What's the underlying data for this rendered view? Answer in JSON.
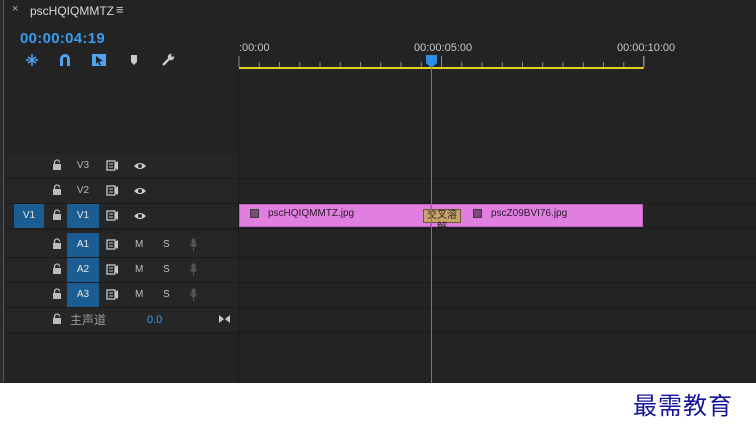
{
  "tab": {
    "close": "×",
    "title": "pscHQIQMMTZ",
    "menu": "≡"
  },
  "timecode": "00:00:04:19",
  "tools": [
    {
      "icon": "nest-icon"
    },
    {
      "icon": "snap-icon"
    },
    {
      "icon": "linked-selection-icon"
    },
    {
      "icon": "add-marker-icon"
    },
    {
      "icon": "settings-wrench-icon"
    }
  ],
  "ruler": {
    "labels": [
      ":00:00",
      "00:00:05:00",
      "00:00:10:00"
    ]
  },
  "tracks": {
    "v3": {
      "name": "V3"
    },
    "v2": {
      "name": "V2"
    },
    "v1": {
      "source": "V1",
      "name": "V1"
    },
    "a1": {
      "name": "A1",
      "mute": "M",
      "solo": "S"
    },
    "a2": {
      "name": "A2",
      "mute": "M",
      "solo": "S"
    },
    "a3": {
      "name": "A3",
      "mute": "M",
      "solo": "S"
    },
    "master": {
      "name": "主声道",
      "value": "0.0"
    }
  },
  "clips": {
    "clip1": {
      "name": "pscHQIQMMTZ.jpg"
    },
    "clip2": {
      "name": "pscZ09BVI76.jpg"
    },
    "transition": "交叉溶解"
  },
  "colors": {
    "accent": "#3a9bef",
    "clip": "#e17fe0",
    "work_area": "#e2d21c",
    "patch": "#1b5d92"
  },
  "watermark": "最需教育"
}
